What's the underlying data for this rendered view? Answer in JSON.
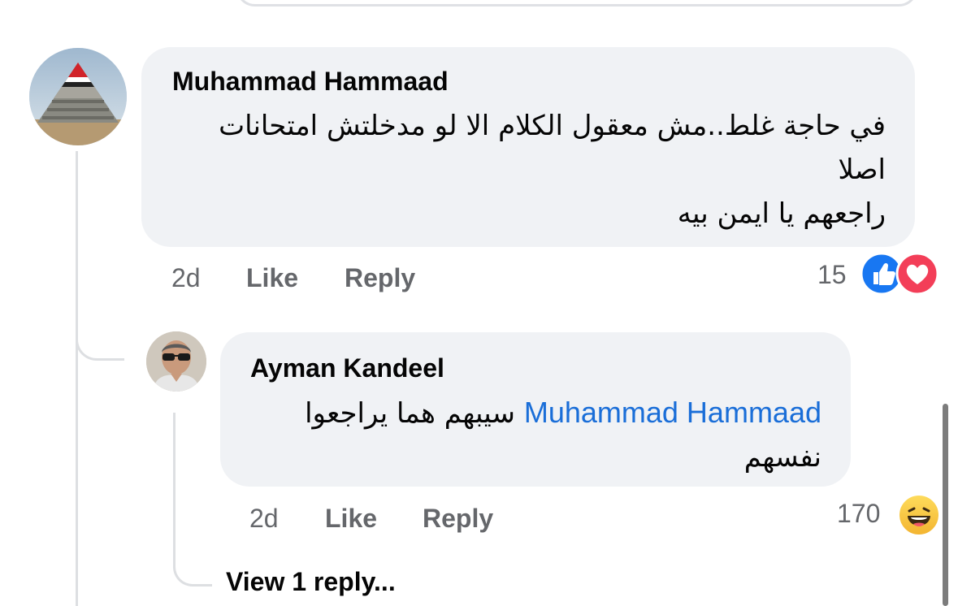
{
  "comment": {
    "author": "Muhammad Hammaad",
    "lines": [
      "في حاجة غلط..مش معقول الكلام الا لو مدخلتش امتحانات",
      "اصلا",
      "راجعهم يا ايمن بيه"
    ],
    "time": "2d",
    "like_label": "Like",
    "reply_label": "Reply",
    "reaction_count": "15",
    "reactions": [
      "like-icon",
      "love-icon"
    ]
  },
  "reply": {
    "author": "Ayman Kandeel",
    "mention": "Muhammad Hammaad",
    "text_after_mention": "سيبهم هما يراجعوا",
    "text_line2": "نفسهم",
    "time": "2d",
    "like_label": "Like",
    "reply_label": "Reply",
    "reaction_count": "170",
    "reactions": [
      "haha-icon"
    ]
  },
  "view_replies_label": "View 1 reply...",
  "colors": {
    "bubble": "#f0f2f5",
    "mention": "#1a6ed8",
    "like_blue": "#1877f2",
    "love_red": "#f33e58",
    "muted": "#65676b"
  }
}
